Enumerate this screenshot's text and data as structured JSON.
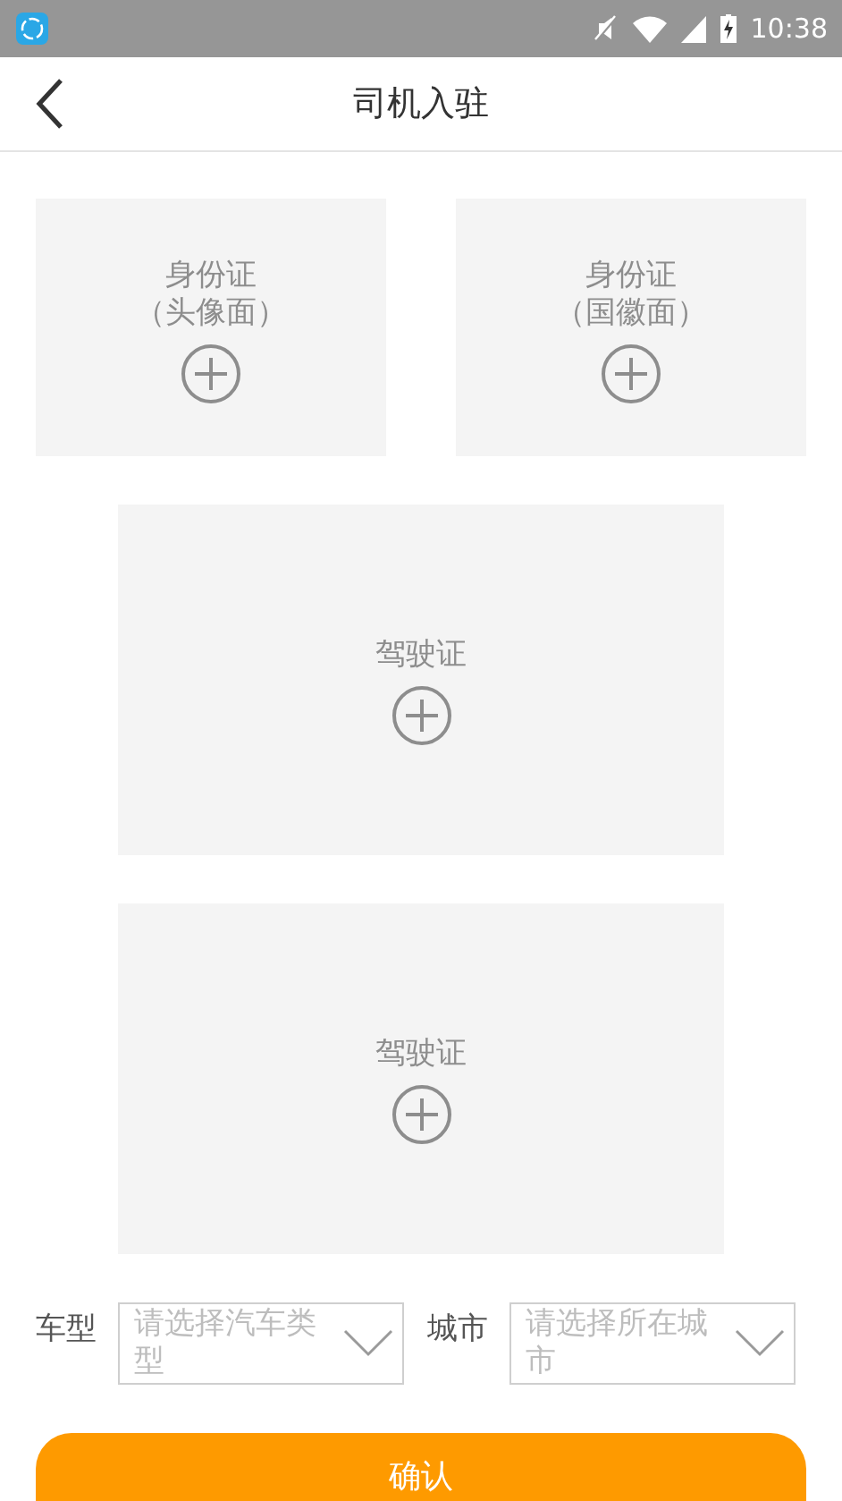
{
  "status_bar": {
    "time": "10:38"
  },
  "header": {
    "title": "司机入驻"
  },
  "id_uploads": [
    {
      "label": "身份证",
      "sublabel": "（头像面）"
    },
    {
      "label": "身份证",
      "sublabel": "（国徽面）"
    }
  ],
  "license_uploads": [
    {
      "label": "驾驶证"
    },
    {
      "label": "驾驶证"
    }
  ],
  "selects": [
    {
      "label": "车型",
      "placeholder": "请选择汽车类型"
    },
    {
      "label": "城市",
      "placeholder": "请选择所在城市"
    }
  ],
  "confirm_button": {
    "label": "确认"
  }
}
